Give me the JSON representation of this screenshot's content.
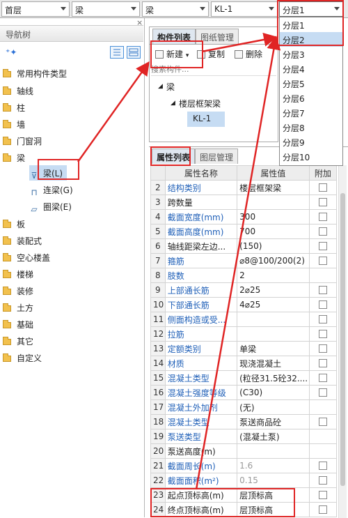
{
  "topbar": {
    "floor_value": "首层",
    "type_value": "梁",
    "subtype_value": "梁",
    "component_value": "KL-1",
    "layer_value": "分层1"
  },
  "left_panel": {
    "title": "导航树",
    "close_glyph": "×",
    "categories": [
      {
        "label": "常用构件类型"
      },
      {
        "label": "轴线"
      },
      {
        "label": "柱"
      },
      {
        "label": "墙"
      },
      {
        "label": "门窗洞"
      },
      {
        "label": "梁"
      },
      {
        "label": "板"
      },
      {
        "label": "装配式"
      },
      {
        "label": "空心楼盖"
      },
      {
        "label": "楼梯"
      },
      {
        "label": "装修"
      },
      {
        "label": "土方"
      },
      {
        "label": "基础"
      },
      {
        "label": "其它"
      },
      {
        "label": "自定义"
      }
    ],
    "beam_children": [
      {
        "label": "梁(L)",
        "icon": "beam-icon"
      },
      {
        "label": "连梁(G)",
        "icon": "link-beam-icon"
      },
      {
        "label": "圈梁(E)",
        "icon": "ring-beam-icon"
      }
    ]
  },
  "component_panel": {
    "tabs": [
      "构件列表",
      "图纸管理"
    ],
    "new_label": "新建",
    "copy_label": "复制",
    "delete_label": "删除",
    "search_placeholder": "搜索构件...",
    "tree": {
      "root": "梁",
      "group": "楼层框架梁",
      "item": "KL-1"
    }
  },
  "property_panel": {
    "tabs": [
      "属性列表",
      "图层管理"
    ],
    "headers": [
      "属性名称",
      "属性值",
      "附加"
    ],
    "rows": [
      {
        "num": "2",
        "name": "结构类别",
        "value": "楼层框架梁",
        "check": true,
        "blue": true
      },
      {
        "num": "3",
        "name": "跨数量",
        "value": "",
        "check": true,
        "blue": false
      },
      {
        "num": "4",
        "name": "截面宽度(mm)",
        "value": "300",
        "check": true,
        "blue": true
      },
      {
        "num": "5",
        "name": "截面高度(mm)",
        "value": "700",
        "check": true,
        "blue": true
      },
      {
        "num": "6",
        "name": "轴线距梁左边...",
        "value": "(150)",
        "check": true,
        "blue": false
      },
      {
        "num": "7",
        "name": "箍筋",
        "value": "⌀8@100/200(2)",
        "check": true,
        "blue": true
      },
      {
        "num": "8",
        "name": "肢数",
        "value": "2",
        "check": false,
        "blue": true
      },
      {
        "num": "9",
        "name": "上部通长筋",
        "value": "2⌀25",
        "check": true,
        "blue": true
      },
      {
        "num": "10",
        "name": "下部通长筋",
        "value": "4⌀25",
        "check": true,
        "blue": true
      },
      {
        "num": "11",
        "name": "侧面构造或受...",
        "value": "",
        "check": true,
        "blue": true
      },
      {
        "num": "12",
        "name": "拉筋",
        "value": "",
        "check": true,
        "blue": true
      },
      {
        "num": "13",
        "name": "定额类别",
        "value": "单梁",
        "check": true,
        "blue": true
      },
      {
        "num": "14",
        "name": "材质",
        "value": "现浇混凝土",
        "check": true,
        "blue": true
      },
      {
        "num": "15",
        "name": "混凝土类型",
        "value": "(粒径31.5砼32....",
        "check": true,
        "blue": true
      },
      {
        "num": "16",
        "name": "混凝土强度等级",
        "value": "(C30)",
        "check": true,
        "blue": true
      },
      {
        "num": "17",
        "name": "混凝土外加剂",
        "value": "(无)",
        "check": false,
        "blue": true
      },
      {
        "num": "18",
        "name": "混凝土类型",
        "value": "泵送商品砼",
        "check": true,
        "blue": true
      },
      {
        "num": "19",
        "name": "泵送类型",
        "value": "(混凝土泵)",
        "check": false,
        "blue": true
      },
      {
        "num": "20",
        "name": "泵送高度(m)",
        "value": "",
        "check": false,
        "blue": false
      },
      {
        "num": "21",
        "name": "截面周长(m)",
        "value": "1.6",
        "check": true,
        "blue": true,
        "gray": true
      },
      {
        "num": "22",
        "name": "截面面积(m²)",
        "value": "0.15",
        "check": true,
        "blue": true,
        "gray": true
      },
      {
        "num": "23",
        "name": "起点顶标高(m)",
        "value": "层顶标高",
        "check": true,
        "blue": false
      },
      {
        "num": "24",
        "name": "终点顶标高(m)",
        "value": "层顶标高",
        "check": true,
        "blue": false
      }
    ]
  },
  "layer_dropdown": {
    "selected": "分层2",
    "options": [
      "分层1",
      "分层2",
      "分层3",
      "分层4",
      "分层5",
      "分层6",
      "分层7",
      "分层8",
      "分层9",
      "分层10"
    ]
  },
  "colors": {
    "highlight_red": "#e02424",
    "selection_blue": "#c6dcf3",
    "link_blue": "#2060b8"
  }
}
